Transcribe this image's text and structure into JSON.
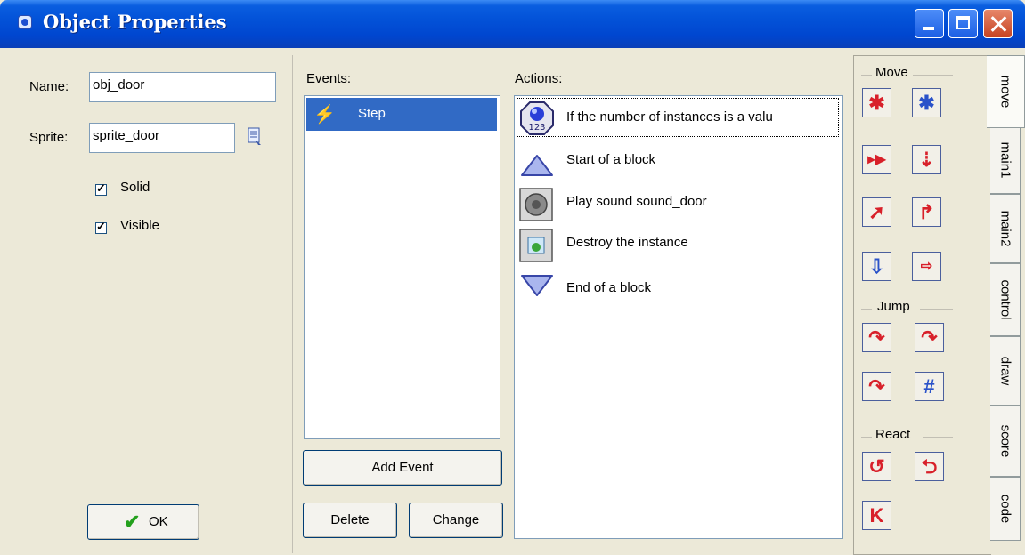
{
  "window": {
    "title": "Object Properties"
  },
  "properties": {
    "name_label": "Name:",
    "name_value": "obj_door",
    "sprite_label": "Sprite:",
    "sprite_value": "sprite_door",
    "solid_label": "Solid",
    "solid_checked": true,
    "visible_label": "Visible",
    "visible_checked": true,
    "ok_label": "OK"
  },
  "events": {
    "header": "Events:",
    "items": [
      {
        "label": "Step",
        "selected": true
      }
    ],
    "add_label": "Add Event",
    "delete_label": "Delete",
    "change_label": "Change"
  },
  "actions": {
    "header": "Actions:",
    "items": [
      {
        "label": "If the number of instances is a valu",
        "icon": "instance-count-icon",
        "selected": true
      },
      {
        "label": "Start of a block",
        "icon": "block-start-icon"
      },
      {
        "label": "Play sound sound_door",
        "icon": "sound-icon"
      },
      {
        "label": "Destroy the instance",
        "icon": "destroy-icon"
      },
      {
        "label": "End of a block",
        "icon": "block-end-icon"
      }
    ]
  },
  "toolbox": {
    "groups": [
      {
        "label": "Move",
        "tools": [
          "move-fixed-icon",
          "move-free-icon",
          "move-towards-icon",
          "speed-horizontal-icon",
          "speed-vertical-icon",
          "move-to-position-icon",
          "gravity-icon",
          "reverse-horizontal-icon"
        ]
      },
      {
        "label": "Jump",
        "tools": [
          "jump-to-position-icon",
          "jump-to-start-icon",
          "jump-random-icon",
          "snap-to-grid-icon"
        ]
      },
      {
        "label": "React",
        "tools": [
          "reverse-direction-icon",
          "bounce-icon",
          "move-to-contact-icon"
        ]
      }
    ],
    "tabs": [
      {
        "label": "move",
        "active": true
      },
      {
        "label": "main1"
      },
      {
        "label": "main2"
      },
      {
        "label": "control"
      },
      {
        "label": "draw"
      },
      {
        "label": "score"
      },
      {
        "label": "code"
      }
    ]
  },
  "colors": {
    "title_bar": "#0352d8",
    "selection": "#316ac5",
    "tool_red": "#d8202a",
    "tool_blue": "#2a52c9"
  }
}
